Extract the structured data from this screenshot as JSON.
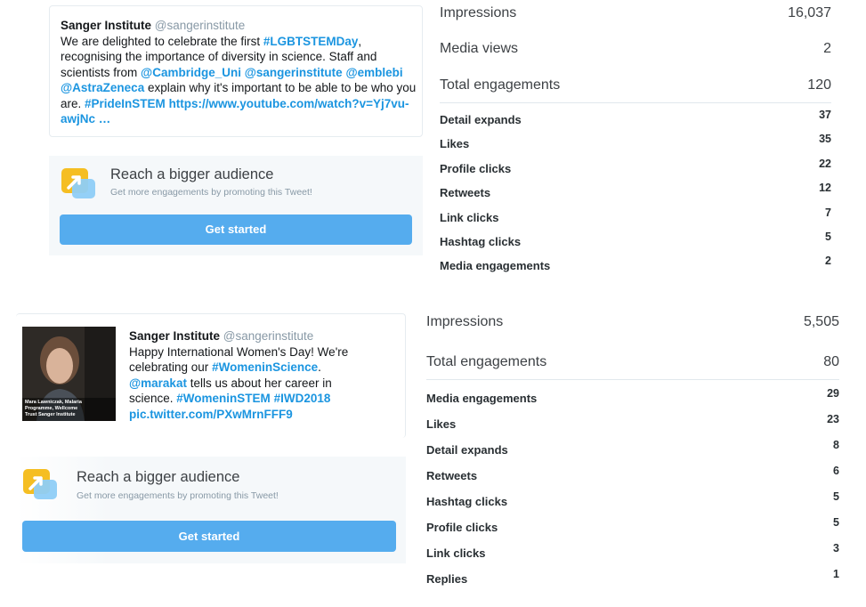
{
  "tweet1": {
    "author": "Sanger Institute",
    "handle": "@sangerinstitute",
    "text_parts": [
      {
        "t": "We are delighted to celebrate the first ",
        "link": false
      },
      {
        "t": "#LGBTSTEMDay",
        "link": true
      },
      {
        "t": ", recognising the importance of diversity in science. Staff and scientists from ",
        "link": false
      },
      {
        "t": "@Cambridge_Uni",
        "link": true
      },
      {
        "t": " ",
        "link": false
      },
      {
        "t": "@sangerinstitute",
        "link": true
      },
      {
        "t": " ",
        "link": false
      },
      {
        "t": "@emblebi",
        "link": true
      },
      {
        "t": " ",
        "link": false
      },
      {
        "t": "@AstraZeneca",
        "link": true
      },
      {
        "t": " explain why it's important to be able to be who you are. ",
        "link": false
      },
      {
        "t": "#PrideInSTEM",
        "link": true
      },
      {
        "t": " ",
        "link": false
      },
      {
        "t": "https://www.youtube.com/watch?v=Yj7vu-awjNc …",
        "link": true
      }
    ],
    "promo": {
      "title": "Reach a bigger audience",
      "subtitle": "Get more engagements by promoting this Tweet!",
      "button": "Get started"
    },
    "stats": {
      "top": [
        {
          "label": "Impressions",
          "value": "16,037"
        },
        {
          "label": "Media views",
          "value": "2"
        },
        {
          "label": "Total engagements",
          "value": "120"
        }
      ],
      "breakdown": [
        {
          "label": "Detail expands",
          "value": "37"
        },
        {
          "label": "Likes",
          "value": "35"
        },
        {
          "label": "Profile clicks",
          "value": "22"
        },
        {
          "label": "Retweets",
          "value": "12"
        },
        {
          "label": "Link clicks",
          "value": "7"
        },
        {
          "label": "Hashtag clicks",
          "value": "5"
        },
        {
          "label": "Media engagements",
          "value": "2"
        }
      ]
    }
  },
  "tweet2": {
    "author": "Sanger Institute",
    "handle": "@sangerinstitute",
    "photo_caption": "Mara Lawniczak, Malaria Programme, Wellcome Trust Sanger Institute",
    "text_parts": [
      {
        "t": "Happy International Women's Day! We're celebrating our ",
        "link": false
      },
      {
        "t": "#WomeninScience",
        "link": true
      },
      {
        "t": ". ",
        "link": false
      },
      {
        "t": "@marakat",
        "link": true
      },
      {
        "t": " tells us about her career in science. ",
        "link": false
      },
      {
        "t": "#WomeninSTEM",
        "link": true
      },
      {
        "t": " ",
        "link": false
      },
      {
        "t": "#IWD2018",
        "link": true
      },
      {
        "t": " ",
        "link": false
      },
      {
        "t": "pic.twitter.com/PXwMrnFFF9",
        "link": true
      }
    ],
    "promo": {
      "title": "Reach a bigger audience",
      "subtitle": "Get more engagements by promoting this Tweet!",
      "button": "Get started"
    },
    "stats": {
      "top": [
        {
          "label": "Impressions",
          "value": "5,505"
        },
        {
          "label": "Total engagements",
          "value": "80"
        }
      ],
      "breakdown": [
        {
          "label": "Media engagements",
          "value": "29"
        },
        {
          "label": "Likes",
          "value": "23"
        },
        {
          "label": "Detail expands",
          "value": "8"
        },
        {
          "label": "Retweets",
          "value": "6"
        },
        {
          "label": "Hashtag clicks",
          "value": "5"
        },
        {
          "label": "Profile clicks",
          "value": "5"
        },
        {
          "label": "Link clicks",
          "value": "3"
        },
        {
          "label": "Replies",
          "value": "1"
        }
      ]
    }
  }
}
